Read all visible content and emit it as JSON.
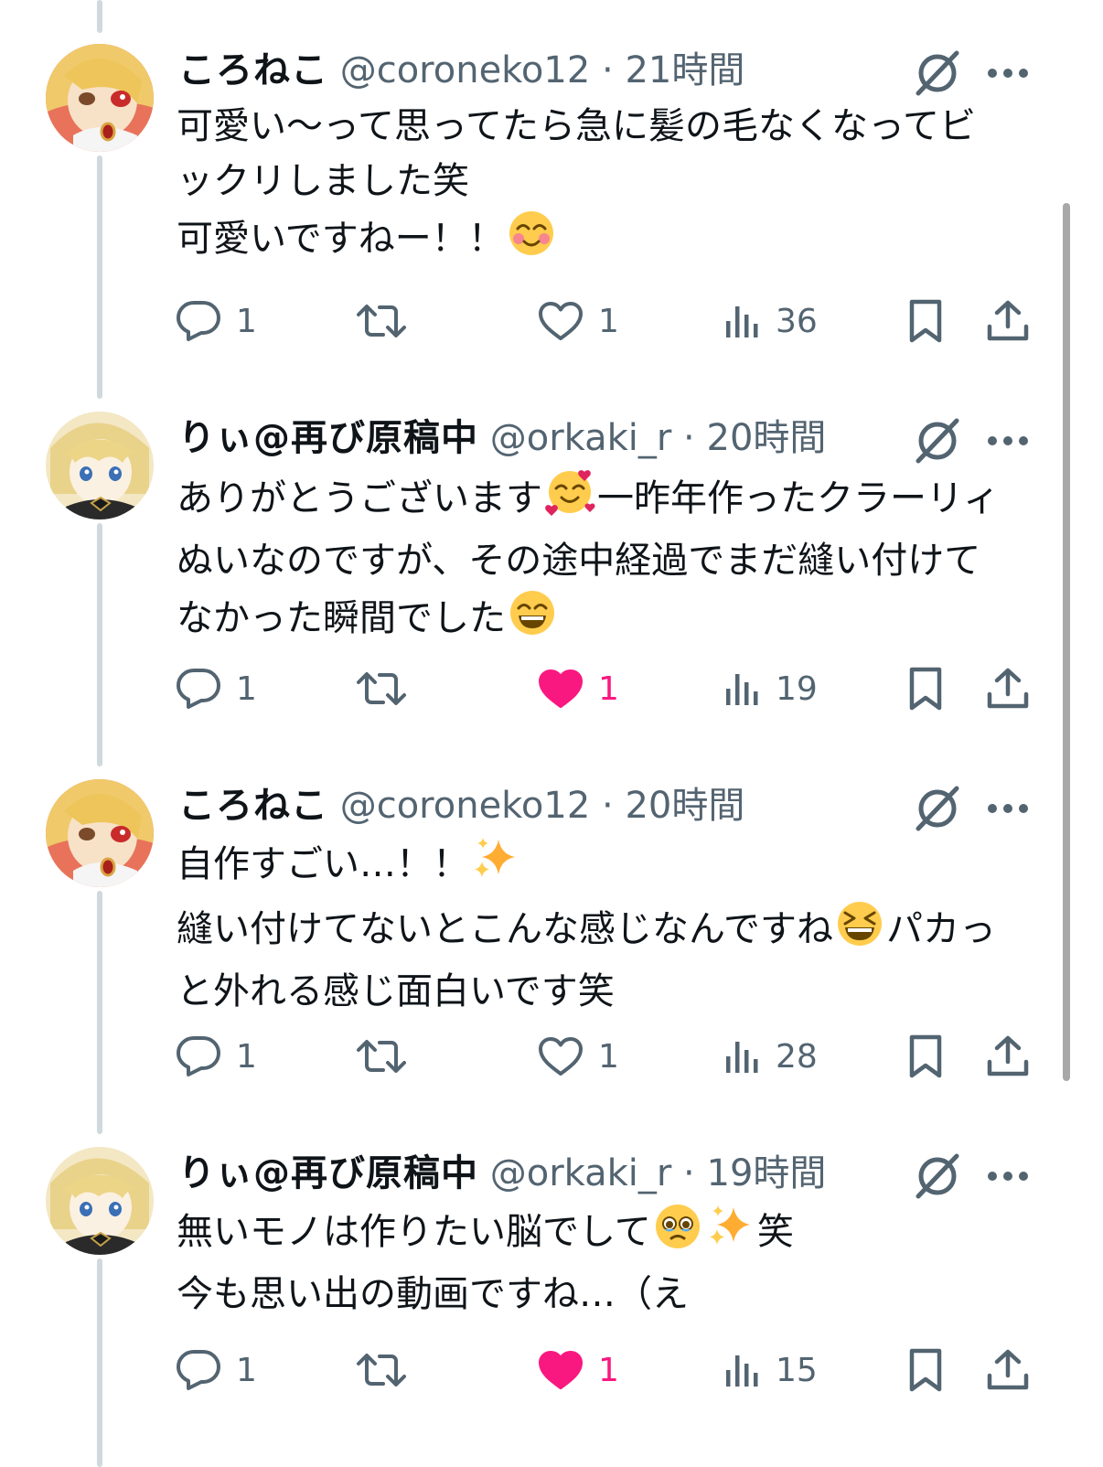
{
  "tweets": [
    {
      "name": "ころねこ",
      "handle": "@coroneko12",
      "time": "21時間",
      "avatar": "coroneko-avatar",
      "lines": [
        [
          "可愛い〜って思ってたら急に髪の毛なくなってビ"
        ],
        [
          "ックリしました笑"
        ],
        [
          "可愛いですねー！！",
          {
            "emoji": "smiling-face-blush"
          }
        ]
      ],
      "replies": "1",
      "retweets": "",
      "likes": "1",
      "liked": false,
      "views": "36"
    },
    {
      "name": "りぃ@再び原稿中",
      "handle": "@orkaki_r",
      "time": "20時間",
      "avatar": "orkaki-avatar",
      "lines": [
        [
          "ありがとうございます",
          {
            "emoji": "smiling-face-hearts"
          },
          "一昨年作ったクラーリィ"
        ],
        [
          "ぬいなのですが、その途中経過でまだ縫い付けて"
        ],
        [
          "なかった瞬間でした",
          {
            "emoji": "grinning-face-smiling-eyes"
          }
        ]
      ],
      "replies": "1",
      "retweets": "",
      "likes": "1",
      "liked": true,
      "views": "19"
    },
    {
      "name": "ころねこ",
      "handle": "@coroneko12",
      "time": "20時間",
      "avatar": "coroneko-avatar",
      "lines": [
        [
          "自作すごい…！！",
          {
            "emoji": "sparkles"
          }
        ],
        [
          "縫い付けてないとこんな感じなんですね",
          {
            "emoji": "grinning-squinting-face"
          },
          "パカっ"
        ],
        [
          "と外れる感じ面白いです笑"
        ]
      ],
      "replies": "1",
      "retweets": "",
      "likes": "1",
      "liked": false,
      "views": "28"
    },
    {
      "name": "りぃ@再び原稿中",
      "handle": "@orkaki_r",
      "time": "19時間",
      "avatar": "orkaki-avatar",
      "lines": [
        [
          "無いモノは作りたい脳でして",
          {
            "emoji": "face-holding-back-tears"
          },
          {
            "emoji": "sparkles"
          },
          "笑"
        ],
        [
          "今も思い出の動画ですね…（え"
        ]
      ],
      "replies": "1",
      "retweets": "",
      "likes": "1",
      "liked": true,
      "views": "15"
    }
  ],
  "colors": {
    "text": "#0f1419",
    "secondary": "#536471",
    "like": "#f91880",
    "thread_line": "#cfd9de"
  },
  "icons": [
    "reply-icon",
    "retweet-icon",
    "like-icon",
    "views-icon",
    "bookmark-icon",
    "share-icon",
    "grok-icon",
    "more-icon"
  ]
}
